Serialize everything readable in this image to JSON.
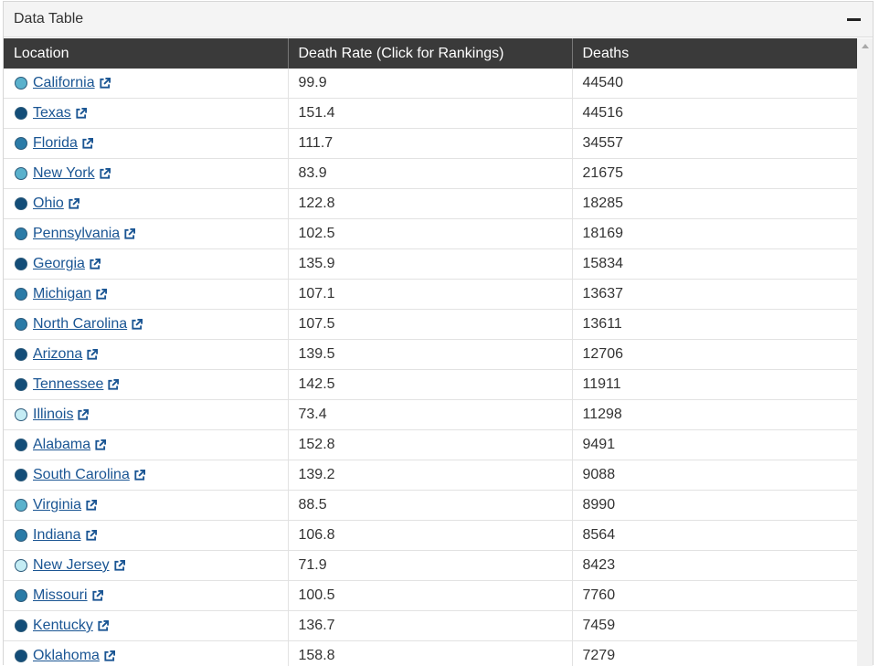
{
  "panel": {
    "title": "Data Table"
  },
  "table": {
    "headers": [
      "Location",
      "Death Rate (Click for Rankings)",
      "Deaths"
    ],
    "rows": [
      {
        "location": "California",
        "rate": "99.9",
        "deaths": "44540",
        "color": "#5ab1cc"
      },
      {
        "location": "Texas",
        "rate": "151.4",
        "deaths": "44516",
        "color": "#134d78"
      },
      {
        "location": "Florida",
        "rate": "111.7",
        "deaths": "34557",
        "color": "#2b7ba7"
      },
      {
        "location": "New York",
        "rate": "83.9",
        "deaths": "21675",
        "color": "#5ab1cc"
      },
      {
        "location": "Ohio",
        "rate": "122.8",
        "deaths": "18285",
        "color": "#134d78"
      },
      {
        "location": "Pennsylvania",
        "rate": "102.5",
        "deaths": "18169",
        "color": "#2b7ba7"
      },
      {
        "location": "Georgia",
        "rate": "135.9",
        "deaths": "15834",
        "color": "#134d78"
      },
      {
        "location": "Michigan",
        "rate": "107.1",
        "deaths": "13637",
        "color": "#2b7ba7"
      },
      {
        "location": "North Carolina",
        "rate": "107.5",
        "deaths": "13611",
        "color": "#2b7ba7"
      },
      {
        "location": "Arizona",
        "rate": "139.5",
        "deaths": "12706",
        "color": "#134d78"
      },
      {
        "location": "Tennessee",
        "rate": "142.5",
        "deaths": "11911",
        "color": "#134d78"
      },
      {
        "location": "Illinois",
        "rate": "73.4",
        "deaths": "11298",
        "color": "#c4ecf4"
      },
      {
        "location": "Alabama",
        "rate": "152.8",
        "deaths": "9491",
        "color": "#134d78"
      },
      {
        "location": "South Carolina",
        "rate": "139.2",
        "deaths": "9088",
        "color": "#134d78"
      },
      {
        "location": "Virginia",
        "rate": "88.5",
        "deaths": "8990",
        "color": "#5ab1cc"
      },
      {
        "location": "Indiana",
        "rate": "106.8",
        "deaths": "8564",
        "color": "#2b7ba7"
      },
      {
        "location": "New Jersey",
        "rate": "71.9",
        "deaths": "8423",
        "color": "#c4ecf4"
      },
      {
        "location": "Missouri",
        "rate": "100.5",
        "deaths": "7760",
        "color": "#2b7ba7"
      },
      {
        "location": "Kentucky",
        "rate": "136.7",
        "deaths": "7459",
        "color": "#134d78"
      },
      {
        "location": "Oklahoma",
        "rate": "158.8",
        "deaths": "7279",
        "color": "#134d78"
      }
    ]
  },
  "icons": {
    "collapse": "minus-icon",
    "external_link": "external-link-icon",
    "scroll_up": "arrow-up-icon"
  }
}
